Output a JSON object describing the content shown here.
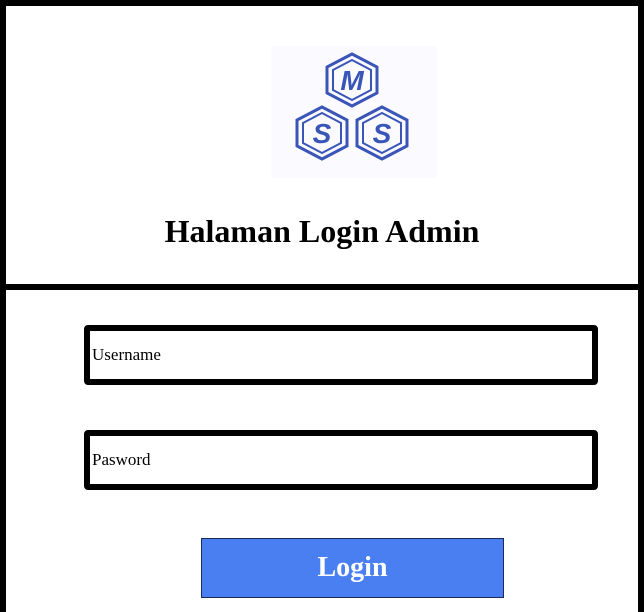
{
  "header": {
    "logo": {
      "icon": "mss-logo",
      "letters": [
        "M",
        "S",
        "S"
      ],
      "color": "#3a55b8"
    },
    "title": "Halaman Login Admin"
  },
  "form": {
    "username_placeholder": "Username",
    "password_placeholder": "Pasword",
    "login_label": "Login",
    "login_color": "#4a7ff2"
  }
}
